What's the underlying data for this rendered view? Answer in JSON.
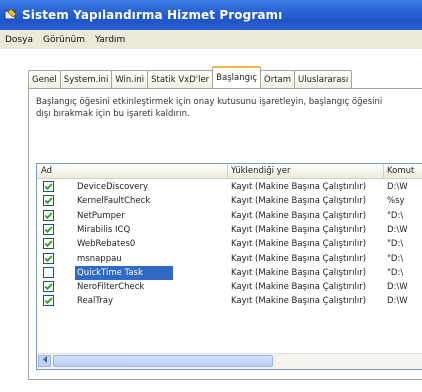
{
  "window": {
    "title": "Sistem Yapılandırma Hizmet Programı"
  },
  "menu": [
    "Dosya",
    "Görünüm",
    "Yardım"
  ],
  "tabs": [
    {
      "label": "Genel",
      "active": false
    },
    {
      "label": "System.ini",
      "active": false
    },
    {
      "label": "Win.ini",
      "active": false
    },
    {
      "label": "Statik VxD'ler",
      "active": false
    },
    {
      "label": "Başlangıç",
      "active": true
    },
    {
      "label": "Ortam",
      "active": false
    },
    {
      "label": "Uluslararası",
      "active": false
    }
  ],
  "description": {
    "line1": "Başlangıç öğesini etkinleştirmek için onay kutusunu işaretleyin, başlangıç öğesini",
    "line2": "dışı bırakmak için bu işareti kaldırın."
  },
  "list": {
    "columns": [
      "Ad",
      "Yüklendiği yer",
      "Komut"
    ],
    "rows": [
      {
        "checked": true,
        "name": "DeviceDiscovery",
        "location": "Kayıt (Makine Başına Çalıştırılır)",
        "command": "D:\\W"
      },
      {
        "checked": true,
        "name": "KernelFaultCheck",
        "location": "Kayıt (Makine Başına Çalıştırılır)",
        "command": "%sy"
      },
      {
        "checked": true,
        "name": "NetPumper",
        "location": "Kayıt (Makine Başına Çalıştırılır)",
        "command": "\"D:\\"
      },
      {
        "checked": true,
        "name": "Mirabilis ICQ",
        "location": "Kayıt (Makine Başına Çalıştırılır)",
        "command": "D:\\W"
      },
      {
        "checked": true,
        "name": "WebRebates0",
        "location": "Kayıt (Makine Başına Çalıştırılır)",
        "command": "\"D:\\"
      },
      {
        "checked": true,
        "name": "msnappau",
        "location": "Kayıt (Makine Başına Çalıştırılır)",
        "command": "\"D:\\"
      },
      {
        "checked": false,
        "name": "QuickTime Task",
        "location": "Kayıt (Makine Başına Çalıştırılır)",
        "command": "\"D:\\"
      },
      {
        "checked": true,
        "name": "NeroFilterCheck",
        "location": "Kayıt (Makine Başına Çalıştırılır)",
        "command": "D:\\W"
      },
      {
        "checked": true,
        "name": "RealTray",
        "location": "Kayıt (Makine Başına Çalıştırılır)",
        "command": "D:\\W"
      }
    ]
  },
  "icons": {
    "app": "system-config-icon",
    "checkbox": "checkmark-icon",
    "scroll_left": "arrow-left-icon"
  },
  "colors": {
    "titlebar": "#2a64d6",
    "selection": "#316ac5",
    "active_tab_accent": "#f3b93f"
  }
}
